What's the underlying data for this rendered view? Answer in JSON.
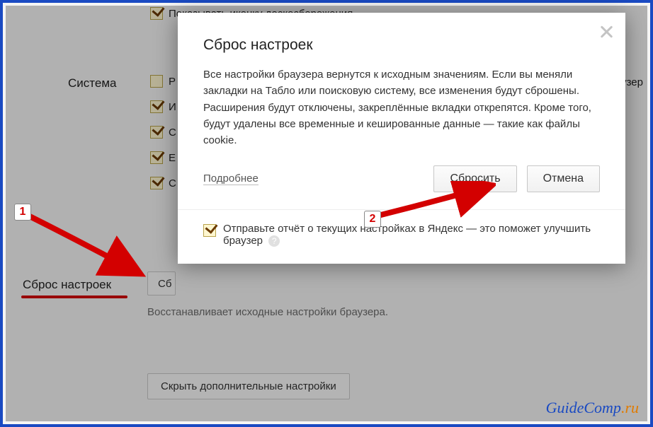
{
  "background": {
    "top_cut_label": "Показывать иконку доскосбережения",
    "system_label": "Система",
    "reset_section_label": "Сброс настроек",
    "checkbox_tail_1": "Р",
    "checkbox_tail_2": "И",
    "checkbox_tail_3": "С",
    "checkbox_tail_4": "Е",
    "checkbox_tail_5": "С",
    "right_cut_text": "раузер",
    "reset_button_cut": "Сб",
    "reset_desc": "Восстанавливает исходные настройки браузера.",
    "hide_adv": "Скрыть дополнительные настройки"
  },
  "modal": {
    "title": "Сброс настроек",
    "body": "Все настройки браузера вернутся к исходным значениям. Если вы меняли закладки на Табло или поисковую систему, все изменения будут сброшены. Расширения будут отключены, закреплённые вкладки открепятся. Кроме того, будут удалены все временные и кешированные данные — такие как файлы cookie.",
    "learn_more": "Подробнее",
    "confirm": "Сбросить",
    "cancel": "Отмена",
    "report_label": "Отправьте отчёт о текущих настройках в Яндекс — это поможет улучшить браузер",
    "help_glyph": "?"
  },
  "annotations": {
    "marker1": "1",
    "marker2": "2"
  },
  "watermark": {
    "part1": "GuideComp",
    "part2": ".ru"
  }
}
